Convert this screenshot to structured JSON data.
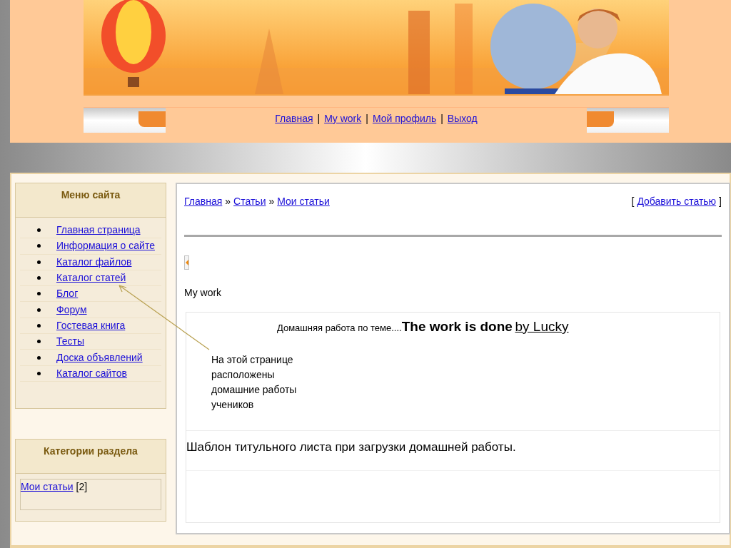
{
  "nav": {
    "links": [
      "Главная",
      "My work",
      "Мой профиль",
      "Выход"
    ],
    "separator": "|"
  },
  "sidebar": {
    "menu": {
      "title": "Меню сайта",
      "items": [
        "Главная страница",
        "Информация о сайте",
        "Каталог файлов",
        "Каталог статей",
        "Блог",
        "Форум",
        "Гостевая книга",
        "Тесты",
        "Доска объявлений",
        "Каталог сайтов"
      ]
    },
    "categories": {
      "title": "Категории раздела",
      "items": [
        {
          "label": "Мои статьи",
          "count": "[2]"
        }
      ]
    }
  },
  "content": {
    "breadcrumbs": [
      "Главная",
      "Статьи",
      "Мои статьи"
    ],
    "breadcrumb_separator": "»",
    "add_link": {
      "open": "[",
      "label": "Добавить статью",
      "close": "]"
    },
    "section_title": "My work",
    "heading": {
      "prefix": "Домашняя работа по теме....",
      "title": "The work is done",
      "author": "by Lucky"
    },
    "template_text": "Шаблон титульного листа при загрузки домашней работы."
  },
  "annotation": {
    "text": "На этой странице расположены домашние работы учеников"
  }
}
